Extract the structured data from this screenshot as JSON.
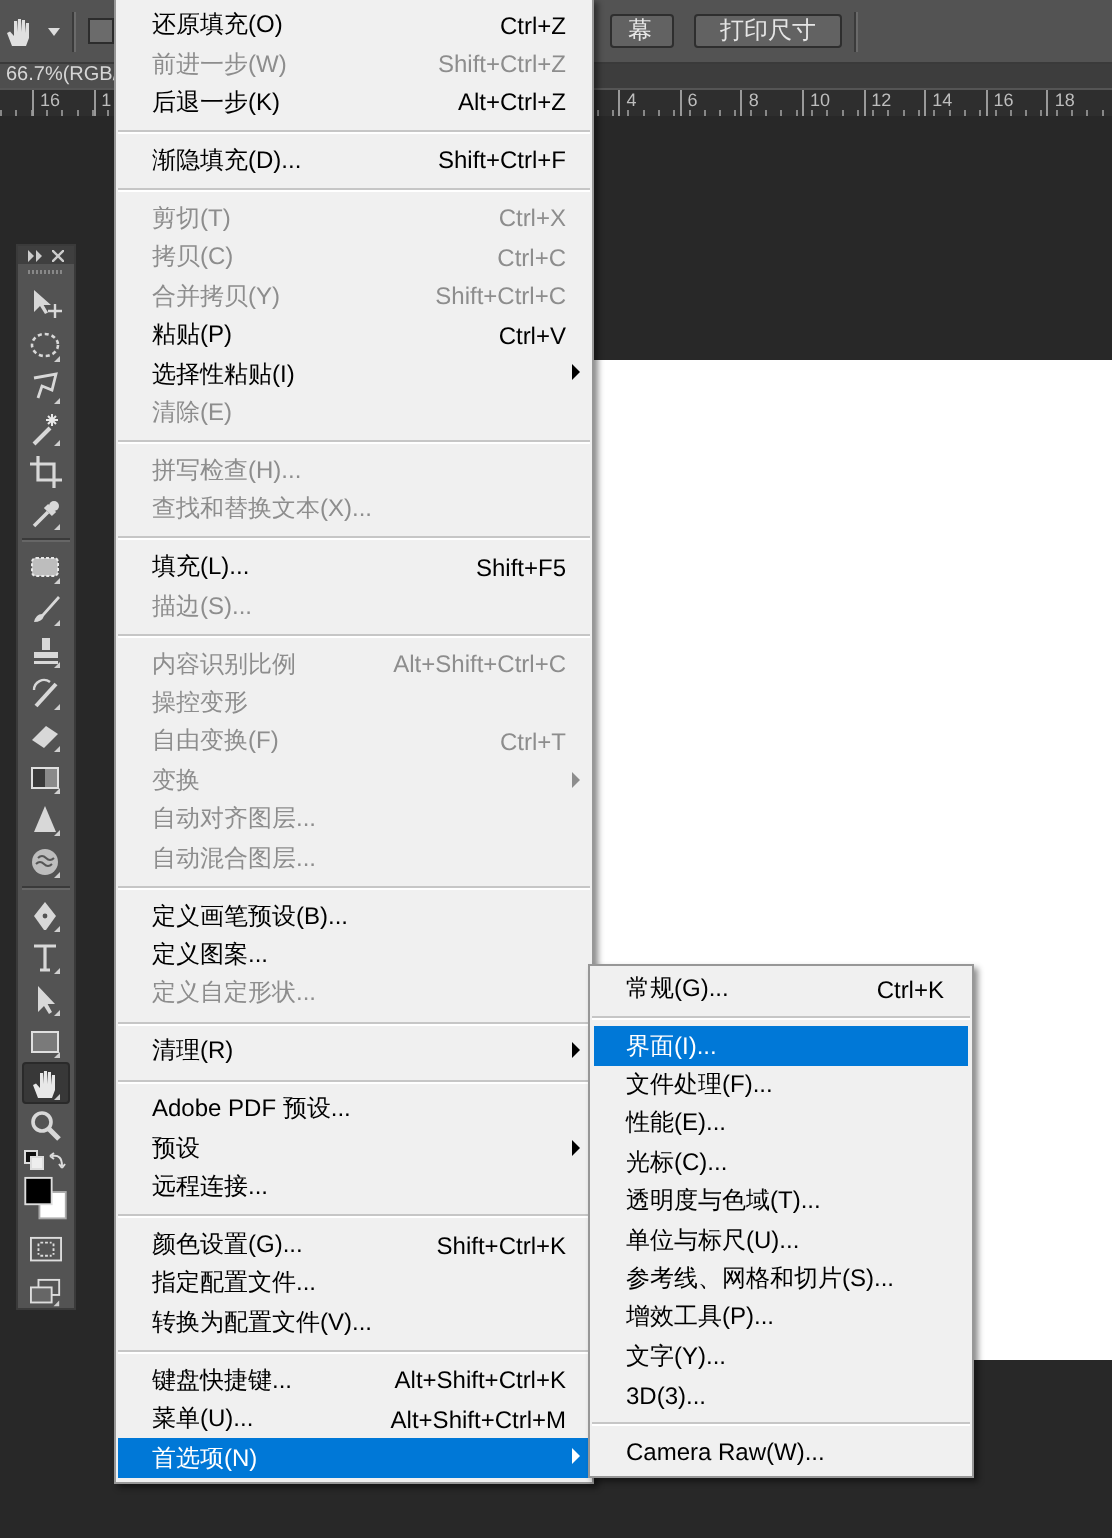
{
  "options_bar": {
    "checkbox": {
      "checked": false
    },
    "buttons": [
      "幕",
      "打印尺寸"
    ]
  },
  "document_tab": {
    "title": "66.7%(RGB/"
  },
  "ruler": {
    "left_labels": [
      "16",
      "1"
    ],
    "right_labels": [
      "4",
      "6",
      "8",
      "10",
      "12",
      "14",
      "16",
      "18"
    ]
  },
  "toolbar": {
    "tool_groups": [
      [
        {
          "kind": "move",
          "selected": false
        },
        {
          "kind": "marquee",
          "selected": false
        },
        {
          "kind": "lasso",
          "selected": false
        },
        {
          "kind": "wand",
          "selected": false
        },
        {
          "kind": "crop",
          "selected": false
        },
        {
          "kind": "eyedropper",
          "selected": false
        }
      ],
      [
        {
          "kind": "bandage",
          "selected": false
        },
        {
          "kind": "brush",
          "selected": false
        },
        {
          "kind": "stamp",
          "selected": false
        },
        {
          "kind": "history-brush",
          "selected": false
        },
        {
          "kind": "eraser",
          "selected": false
        },
        {
          "kind": "gradient",
          "selected": false
        },
        {
          "kind": "blur",
          "selected": false
        },
        {
          "kind": "sponge",
          "selected": false
        }
      ],
      [
        {
          "kind": "pen",
          "selected": false
        },
        {
          "kind": "type",
          "selected": false
        },
        {
          "kind": "arrow",
          "selected": false
        },
        {
          "kind": "rectangle",
          "selected": false
        }
      ],
      [
        {
          "kind": "hand",
          "selected": true
        },
        {
          "kind": "zoom",
          "selected": false
        }
      ]
    ]
  },
  "edit_menu": {
    "groups": [
      [
        {
          "label": "还原填充(O)",
          "shortcut": "Ctrl+Z",
          "disabled": false,
          "submenu": false,
          "selected": false
        },
        {
          "label": "前进一步(W)",
          "shortcut": "Shift+Ctrl+Z",
          "disabled": true,
          "submenu": false,
          "selected": false
        },
        {
          "label": "后退一步(K)",
          "shortcut": "Alt+Ctrl+Z",
          "disabled": false,
          "submenu": false,
          "selected": false
        }
      ],
      [
        {
          "label": "渐隐填充(D)...",
          "shortcut": "Shift+Ctrl+F",
          "disabled": false,
          "submenu": false,
          "selected": false
        }
      ],
      [
        {
          "label": "剪切(T)",
          "shortcut": "Ctrl+X",
          "disabled": true,
          "submenu": false,
          "selected": false
        },
        {
          "label": "拷贝(C)",
          "shortcut": "Ctrl+C",
          "disabled": true,
          "submenu": false,
          "selected": false
        },
        {
          "label": "合并拷贝(Y)",
          "shortcut": "Shift+Ctrl+C",
          "disabled": true,
          "submenu": false,
          "selected": false
        },
        {
          "label": "粘贴(P)",
          "shortcut": "Ctrl+V",
          "disabled": false,
          "submenu": false,
          "selected": false
        },
        {
          "label": "选择性粘贴(I)",
          "disabled": false,
          "submenu": true,
          "selected": false
        },
        {
          "label": "清除(E)",
          "disabled": true,
          "submenu": false,
          "selected": false
        }
      ],
      [
        {
          "label": "拼写检查(H)...",
          "disabled": true,
          "submenu": false,
          "selected": false
        },
        {
          "label": "查找和替换文本(X)...",
          "disabled": true,
          "submenu": false,
          "selected": false
        }
      ],
      [
        {
          "label": "填充(L)...",
          "shortcut": "Shift+F5",
          "disabled": false,
          "submenu": false,
          "selected": false
        },
        {
          "label": "描边(S)...",
          "disabled": true,
          "submenu": false,
          "selected": false
        }
      ],
      [
        {
          "label": "内容识别比例",
          "shortcut": "Alt+Shift+Ctrl+C",
          "disabled": true,
          "submenu": false,
          "selected": false
        },
        {
          "label": "操控变形",
          "disabled": true,
          "submenu": false,
          "selected": false
        },
        {
          "label": "自由变换(F)",
          "shortcut": "Ctrl+T",
          "disabled": true,
          "submenu": false,
          "selected": false
        },
        {
          "label": "变换",
          "disabled": true,
          "submenu": true,
          "selected": false
        },
        {
          "label": "自动对齐图层...",
          "disabled": true,
          "submenu": false,
          "selected": false
        },
        {
          "label": "自动混合图层...",
          "disabled": true,
          "submenu": false,
          "selected": false
        }
      ],
      [
        {
          "label": "定义画笔预设(B)...",
          "disabled": false,
          "submenu": false,
          "selected": false
        },
        {
          "label": "定义图案...",
          "disabled": false,
          "submenu": false,
          "selected": false
        },
        {
          "label": "定义自定形状...",
          "disabled": true,
          "submenu": false,
          "selected": false
        }
      ],
      [
        {
          "label": "清理(R)",
          "disabled": false,
          "submenu": true,
          "selected": false
        }
      ],
      [
        {
          "label": "Adobe PDF 预设...",
          "disabled": false,
          "submenu": false,
          "selected": false
        },
        {
          "label": "预设",
          "disabled": false,
          "submenu": true,
          "selected": false
        },
        {
          "label": "远程连接...",
          "disabled": false,
          "submenu": false,
          "selected": false
        }
      ],
      [
        {
          "label": "颜色设置(G)...",
          "shortcut": "Shift+Ctrl+K",
          "disabled": false,
          "submenu": false,
          "selected": false
        },
        {
          "label": "指定配置文件...",
          "disabled": false,
          "submenu": false,
          "selected": false
        },
        {
          "label": "转换为配置文件(V)...",
          "disabled": false,
          "submenu": false,
          "selected": false
        }
      ],
      [
        {
          "label": "键盘快捷键...",
          "shortcut": "Alt+Shift+Ctrl+K",
          "disabled": false,
          "submenu": false,
          "selected": false
        },
        {
          "label": "菜单(U)...",
          "shortcut": "Alt+Shift+Ctrl+M",
          "disabled": false,
          "submenu": false,
          "selected": false
        },
        {
          "label": "首选项(N)",
          "disabled": false,
          "submenu": true,
          "selected": true
        }
      ]
    ]
  },
  "preferences_submenu": {
    "groups": [
      [
        {
          "label": "常规(G)...",
          "shortcut": "Ctrl+K",
          "selected": false
        }
      ],
      [
        {
          "label": "界面(I)...",
          "selected": true
        },
        {
          "label": "文件处理(F)...",
          "selected": false
        },
        {
          "label": "性能(E)...",
          "selected": false
        },
        {
          "label": "光标(C)...",
          "selected": false
        },
        {
          "label": "透明度与色域(T)...",
          "selected": false
        },
        {
          "label": "单位与标尺(U)...",
          "selected": false
        },
        {
          "label": "参考线、网格和切片(S)...",
          "selected": false
        },
        {
          "label": "增效工具(P)...",
          "selected": false
        },
        {
          "label": "文字(Y)...",
          "selected": false
        },
        {
          "label": "3D(3)...",
          "selected": false
        }
      ],
      [
        {
          "label": "Camera Raw(W)...",
          "selected": false
        }
      ]
    ]
  }
}
